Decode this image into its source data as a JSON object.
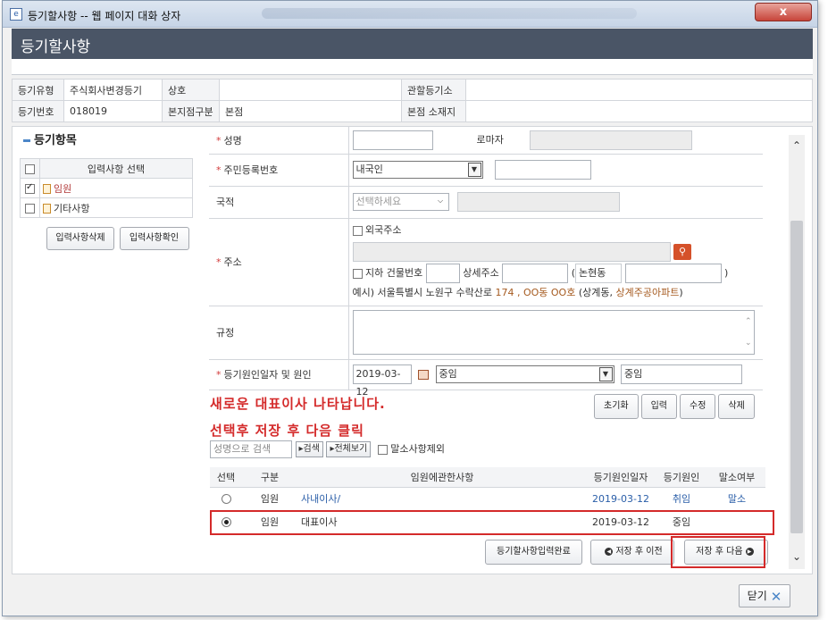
{
  "window": {
    "title": "등기할사항 -- 웹 페이지 대화 상자",
    "close": "x"
  },
  "header": {
    "title": "등기할사항"
  },
  "info": {
    "type_label": "등기유형",
    "type_value": "주식회사변경등기",
    "name_label": "상호",
    "name_value": "",
    "office_label": "관할등기소",
    "office_value": "",
    "no_label": "등기번호",
    "no_value": "018019",
    "branch_label": "본지점구분",
    "branch_value": "본점",
    "addr_label": "본점 소재지",
    "addr_value": ""
  },
  "left": {
    "title": "등기항목",
    "col_header": "입력사항 선택",
    "items": [
      {
        "label": "임원",
        "checked": true
      },
      {
        "label": "기타사항",
        "checked": false
      }
    ],
    "btn_delete": "입력사항삭제",
    "btn_confirm": "입력사항확인"
  },
  "form": {
    "name_label": "성명",
    "roman_label": "로마자",
    "rrn_label": "주민등록번호",
    "rrn_select": "내국인",
    "nation_label": "국적",
    "nation_select": "선택하세요",
    "addr_label": "주소",
    "foreign_addr": "외국주소",
    "underground": "지하",
    "bldg_no": "건물번호",
    "detail_addr": "상세주소",
    "paren_open": "(",
    "dong_label": "논현동",
    "paren_close": ")",
    "addr_ex_prefix": "예시) 서울특별시 노원구 수락산로 ",
    "addr_ex_num": "174 , OO동 OO호",
    "addr_ex_mid": " (상계동, ",
    "addr_ex_apt": "상계주공아파트",
    "addr_ex_end": ")",
    "rule_label": "규정",
    "date_label": "등기원인일자 및 원인",
    "date_value": "2019-03-12",
    "cause_select": "중임",
    "cause_text": "중임"
  },
  "annotations": {
    "line1": "새로운 대표이사 나타납니다.",
    "line2": "선택후 저장 후 다음 클릭"
  },
  "actions": {
    "reset": "초기화",
    "input": "입력",
    "edit": "수정",
    "delete": "삭제"
  },
  "search": {
    "placeholder": "성명으로 검색",
    "search_btn": "검색",
    "all_btn": "전체보기",
    "exclude": "말소사항제외"
  },
  "results": {
    "headers": [
      "선택",
      "구분",
      "임원에관한사항",
      "등기원인일자",
      "등기원인",
      "말소여부"
    ],
    "rows": [
      {
        "type": "임원",
        "desc": "사내이사/",
        "date": "2019-03-12",
        "cause": "취임",
        "erased": "말소",
        "selected": false
      },
      {
        "type": "임원",
        "desc": "대표이사",
        "date": "2019-03-12",
        "cause": "중임",
        "erased": "",
        "selected": true
      }
    ]
  },
  "bottom": {
    "complete": "등기할사항입력완료",
    "prev": "저장 후 이전",
    "next": "저장 후 다음"
  },
  "footer": {
    "close": "닫기"
  },
  "colors": {
    "header_bg": "#4a5566",
    "annotation": "#d42a2a",
    "accent": "#4b86c8"
  }
}
